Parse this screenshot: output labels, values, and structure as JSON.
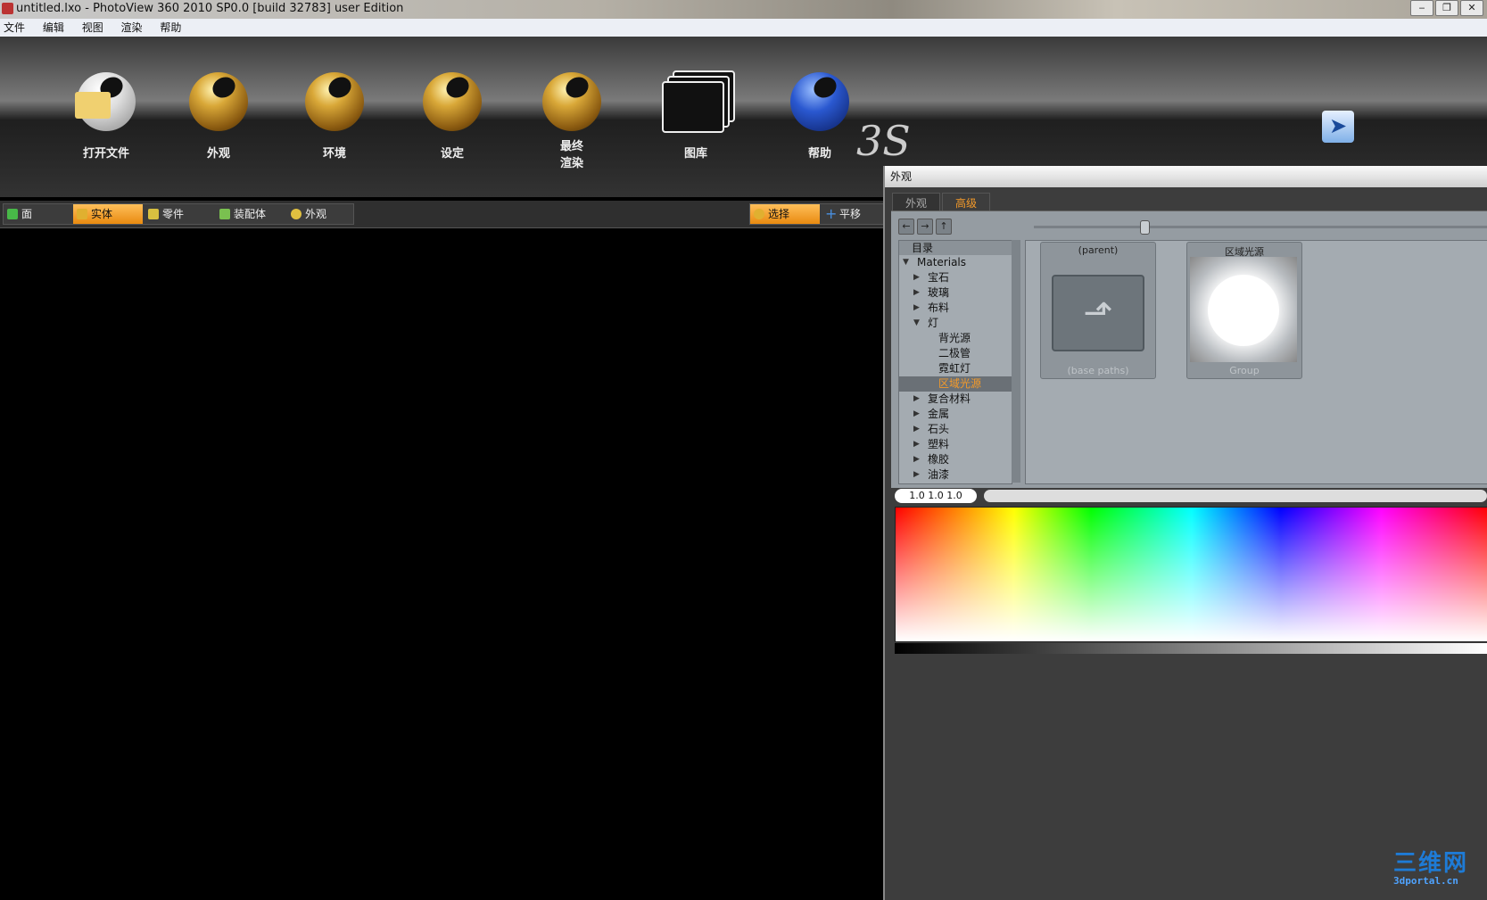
{
  "window": {
    "title": "untitled.lxo - PhotoView 360 2010 SP0.0 [build 32783] user Edition",
    "controls": [
      "‒",
      "❐",
      "✕"
    ]
  },
  "menu": [
    "文件",
    "编辑",
    "视图",
    "渲染",
    "帮助"
  ],
  "toolbar": {
    "tools": [
      {
        "id": "open",
        "label": "打开文件",
        "icon": "open-file-icon"
      },
      {
        "id": "appearance",
        "label": "外观",
        "icon": "appearance-icon"
      },
      {
        "id": "environment",
        "label": "环境",
        "icon": "environment-icon"
      },
      {
        "id": "settings",
        "label": "设定",
        "icon": "settings-icon"
      },
      {
        "id": "final-render",
        "label": "最终\n渲染",
        "icon": "final-render-icon"
      },
      {
        "id": "gallery",
        "label": "图库",
        "icon": "gallery-icon"
      },
      {
        "id": "help",
        "label": "帮助",
        "icon": "help-icon"
      }
    ],
    "brand": "3S",
    "back_icon": "back-arrow-icon"
  },
  "selection_modes": [
    {
      "label": "面",
      "active": false,
      "color": "#48b848"
    },
    {
      "label": "实体",
      "active": true,
      "color": "#e0b030"
    },
    {
      "label": "零件",
      "active": false,
      "color": "#d8c040"
    },
    {
      "label": "装配体",
      "active": false,
      "color": "#7ac050"
    },
    {
      "label": "外观",
      "active": false,
      "color": "#e0c040"
    }
  ],
  "action_modes": [
    {
      "label": "选择",
      "active": true,
      "color": "#e0b030"
    },
    {
      "label": "平移",
      "active": false,
      "color": "#4a90e0"
    }
  ],
  "panel": {
    "title": "外观",
    "tabs": [
      {
        "label": "外观",
        "active": false
      },
      {
        "label": "高级",
        "active": true
      }
    ],
    "nav_buttons": [
      "←",
      "→",
      "↑"
    ],
    "tree_header": "目录",
    "tree": [
      {
        "label": "Materials",
        "expanded": true,
        "level": 0,
        "selected": false
      },
      {
        "label": "宝石",
        "expanded": false,
        "level": 1,
        "selected": false
      },
      {
        "label": "玻璃",
        "expanded": false,
        "level": 1,
        "selected": false
      },
      {
        "label": "布料",
        "expanded": false,
        "level": 1,
        "selected": false
      },
      {
        "label": "灯",
        "expanded": true,
        "level": 1,
        "selected": false
      },
      {
        "label": "背光源",
        "level": 2,
        "selected": false
      },
      {
        "label": "二极管",
        "level": 2,
        "selected": false
      },
      {
        "label": "霓虹灯",
        "level": 2,
        "selected": false
      },
      {
        "label": "区域光源",
        "level": 2,
        "selected": true
      },
      {
        "label": "复合材料",
        "expanded": false,
        "level": 1,
        "selected": false
      },
      {
        "label": "金属",
        "expanded": false,
        "level": 1,
        "selected": false
      },
      {
        "label": "石头",
        "expanded": false,
        "level": 1,
        "selected": false
      },
      {
        "label": "塑料",
        "expanded": false,
        "level": 1,
        "selected": false
      },
      {
        "label": "橡胶",
        "expanded": false,
        "level": 1,
        "selected": false
      },
      {
        "label": "油漆",
        "expanded": false,
        "level": 1,
        "selected": false
      }
    ],
    "items": [
      {
        "caption": "(parent)",
        "sub": "(base paths)",
        "icon": "folder-up-icon"
      },
      {
        "caption": "区域光源",
        "sub": "Group",
        "icon": "area-light-preview"
      }
    ],
    "color_values": "1.0  1.0  1.0"
  },
  "watermark": {
    "big": "三维网",
    "small": "3dportal.cn"
  }
}
